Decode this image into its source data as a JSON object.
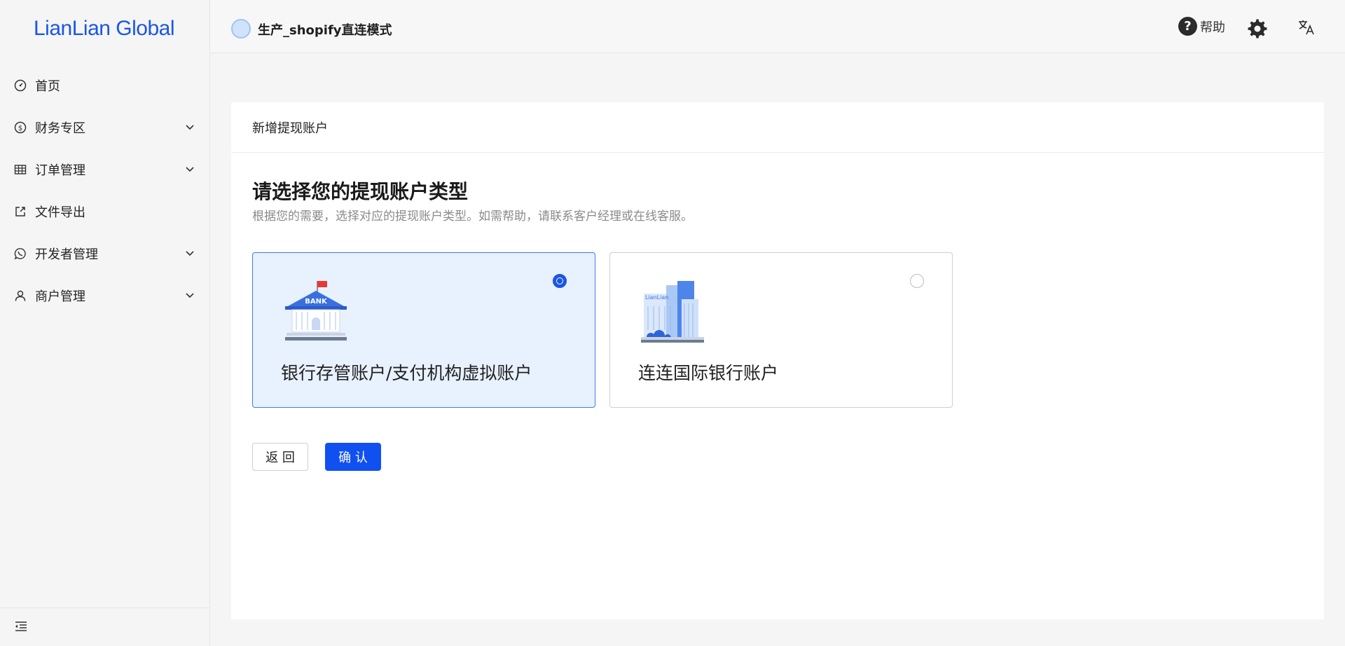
{
  "sidebar": {
    "logo": "LianLian Global",
    "items": [
      {
        "label": "首页",
        "icon": "dashboard-icon",
        "expandable": false
      },
      {
        "label": "财务专区",
        "icon": "dollar-circle-icon",
        "expandable": true
      },
      {
        "label": "订单管理",
        "icon": "table-icon",
        "expandable": true
      },
      {
        "label": "文件导出",
        "icon": "export-icon",
        "expandable": false
      },
      {
        "label": "开发者管理",
        "icon": "whatsapp-icon",
        "expandable": true
      },
      {
        "label": "商户管理",
        "icon": "user-icon",
        "expandable": true
      }
    ],
    "collapse_icon": "menu-fold-icon"
  },
  "header": {
    "app_title": "生产_shopify直连模式",
    "help_label": "帮助",
    "settings_icon": "gear-icon",
    "language_icon": "translate-icon"
  },
  "main": {
    "card_title": "新增提现账户",
    "page_title": "请选择您的提现账户类型",
    "page_desc": "根据您的需要，选择对应的提现账户类型。如需帮助，请联系客户经理或在线客服。",
    "options": [
      {
        "label": "银行存管账户/支付机构虚拟账户",
        "image_text": "BANK",
        "selected": true
      },
      {
        "label": "连连国际银行账户",
        "image_text": "LianLian",
        "selected": false
      }
    ],
    "back_label": "返 回",
    "confirm_label": "确 认"
  },
  "colors": {
    "brand": "#1a55e6",
    "primary_button": "#1150f0",
    "selected_bg": "#e8f1fe",
    "selected_border": "#3d7cf0"
  }
}
